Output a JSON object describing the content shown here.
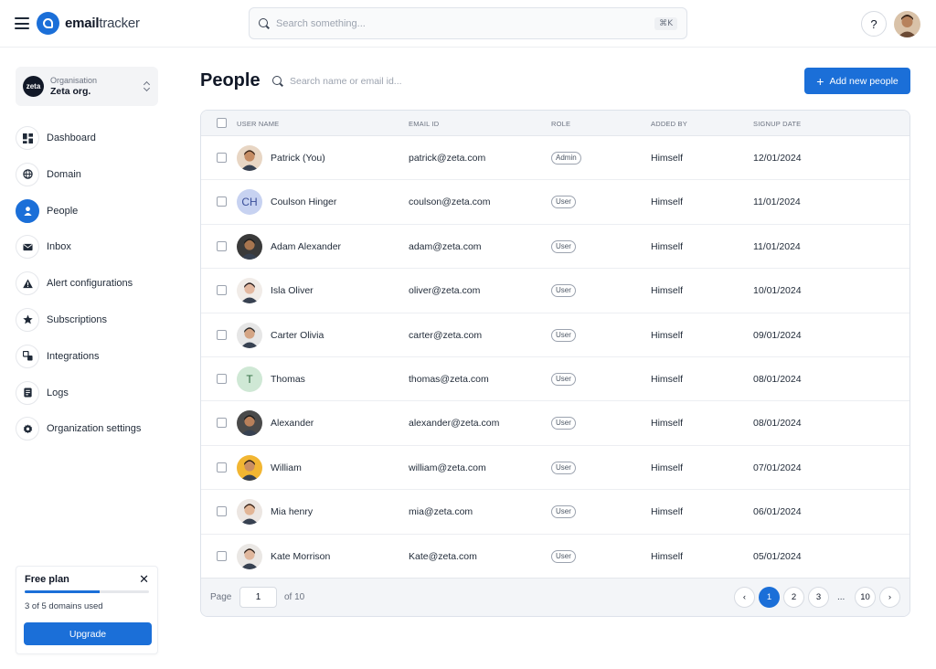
{
  "header": {
    "brand_bold": "email",
    "brand_rest": "tracker",
    "search_placeholder": "Search something...",
    "search_shortcut": "⌘K",
    "help_label": "?"
  },
  "sidebar": {
    "org_label": "Organisation",
    "org_name": "Zeta org.",
    "org_logo_text": "zeta",
    "items": [
      {
        "label": "Dashboard",
        "icon": "dashboard-icon"
      },
      {
        "label": "Domain",
        "icon": "globe-icon"
      },
      {
        "label": "People",
        "icon": "user-icon",
        "active": true
      },
      {
        "label": "Inbox",
        "icon": "mail-icon"
      },
      {
        "label": "Alert configurations",
        "icon": "alert-icon"
      },
      {
        "label": "Subscriptions",
        "icon": "star-icon"
      },
      {
        "label": "Integrations",
        "icon": "integrations-icon"
      },
      {
        "label": "Logs",
        "icon": "logs-icon"
      },
      {
        "label": "Organization settings",
        "icon": "gear-icon"
      }
    ],
    "plan": {
      "title": "Free plan",
      "usage_text": "3 of 5 domains used",
      "usage_fraction": 0.6,
      "upgrade_label": "Upgrade",
      "close": "✕"
    }
  },
  "main": {
    "title": "People",
    "search_placeholder": "Search name or email id...",
    "add_button": "Add new people",
    "columns": [
      "USER NAME",
      "EMAIL ID",
      "ROLE",
      "ADDED BY",
      "SIGNUP DATE"
    ],
    "rows": [
      {
        "name": "Patrick (You)",
        "email": "patrick@zeta.com",
        "role": "Admin",
        "added_by": "Himself",
        "date": "12/01/2024",
        "avatar": "photo",
        "skin": "#c58c64",
        "hair": "#3b2417",
        "bg": "#e8d6c4"
      },
      {
        "name": "Coulson Hinger",
        "email": "coulson@zeta.com",
        "role": "User",
        "added_by": "Himself",
        "date": "11/01/2024",
        "avatar": "CH",
        "bg": "#c7d2f1",
        "fg": "#3b4f9a"
      },
      {
        "name": "Adam Alexander",
        "email": "adam@zeta.com",
        "role": "User",
        "added_by": "Himself",
        "date": "11/01/2024",
        "avatar": "photo",
        "skin": "#a8754f",
        "hair": "#1d1d1d",
        "bg": "#3a3a3a"
      },
      {
        "name": "Isla Oliver",
        "email": "oliver@zeta.com",
        "role": "User",
        "added_by": "Himself",
        "date": "10/01/2024",
        "avatar": "photo",
        "skin": "#e3b8a0",
        "hair": "#2b2020",
        "bg": "#f1ece8"
      },
      {
        "name": "Carter Olivia",
        "email": "carter@zeta.com",
        "role": "User",
        "added_by": "Himself",
        "date": "09/01/2024",
        "avatar": "photo",
        "skin": "#d4a585",
        "hair": "#2a2a2a",
        "bg": "#e6e6e6"
      },
      {
        "name": "Thomas",
        "email": "thomas@zeta.com",
        "role": "User",
        "added_by": "Himself",
        "date": "08/01/2024",
        "avatar": "T",
        "bg": "#cfe8d5",
        "fg": "#2e6b3f"
      },
      {
        "name": "Alexander",
        "email": "alexander@zeta.com",
        "role": "User",
        "added_by": "Himself",
        "date": "08/01/2024",
        "avatar": "photo",
        "skin": "#b9805a",
        "hair": "#1a1a1a",
        "bg": "#4a4a4a"
      },
      {
        "name": "William",
        "email": "william@zeta.com",
        "role": "User",
        "added_by": "Himself",
        "date": "07/01/2024",
        "avatar": "photo",
        "skin": "#c98e63",
        "hair": "#2b1d14",
        "bg": "#f2b632"
      },
      {
        "name": "Mia henry",
        "email": "mia@zeta.com",
        "role": "User",
        "added_by": "Himself",
        "date": "06/01/2024",
        "avatar": "photo",
        "skin": "#e2b596",
        "hair": "#3a2418",
        "bg": "#ece6e2"
      },
      {
        "name": "Kate Morrison",
        "email": "Kate@zeta.com",
        "role": "User",
        "added_by": "Himself",
        "date": "05/01/2024",
        "avatar": "photo",
        "skin": "#e0b79d",
        "hair": "#2d1f18",
        "bg": "#eae7e4"
      }
    ],
    "pagination": {
      "page_label": "Page",
      "page_value": "1",
      "of_label": "of 10",
      "pages": [
        "1",
        "2",
        "3"
      ],
      "ellipsis": "...",
      "last_page": "10",
      "prev": "‹",
      "next": "›"
    }
  },
  "colors": {
    "accent": "#1b6fd8"
  }
}
